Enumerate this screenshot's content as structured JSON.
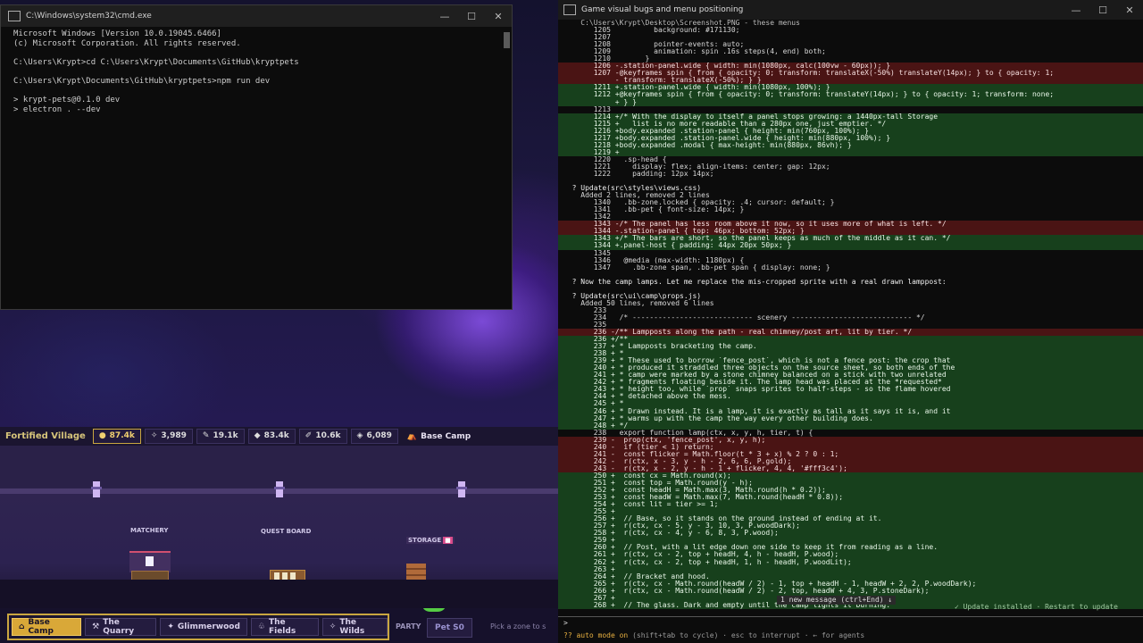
{
  "cmd": {
    "title": "C:\\Windows\\system32\\cmd.exe",
    "lines": [
      "Microsoft Windows [Version 10.0.19045.6466]",
      "(c) Microsoft Corporation. All rights reserved.",
      "",
      "C:\\Users\\Krypt>cd C:\\Users\\Krypt\\Documents\\GitHub\\kryptpets",
      "",
      "C:\\Users\\Krypt\\Documents\\GitHub\\kryptpets>npm run dev",
      "",
      "> krypt-pets@0.1.0 dev",
      "> electron . --dev"
    ]
  },
  "game": {
    "village": "Fortified Village",
    "resources": [
      {
        "icon": "coin-icon",
        "glyph": "●",
        "value": "87.4k"
      },
      {
        "icon": "crystal-icon",
        "glyph": "✧",
        "value": "3,989"
      },
      {
        "icon": "wood-icon",
        "glyph": "✎",
        "value": "19.1k"
      },
      {
        "icon": "stone-icon",
        "glyph": "◆",
        "value": "83.4k"
      },
      {
        "icon": "feather-icon",
        "glyph": "✐",
        "value": "10.6k"
      },
      {
        "icon": "gem-icon",
        "glyph": "◈",
        "value": "6,089"
      }
    ],
    "current_zone": "Base Camp",
    "buildings": {
      "matchery": "MATCHERY",
      "quest_board": "QUEST BOARD",
      "storage": "STORAGE"
    },
    "zones": [
      {
        "label": "Base Camp",
        "icon": "⌂",
        "active": true
      },
      {
        "label": "The Quarry",
        "icon": "⚒",
        "active": false
      },
      {
        "label": "Glimmerwood",
        "icon": "✦",
        "active": false
      },
      {
        "label": "The Fields",
        "icon": "♧",
        "active": false
      },
      {
        "label": "The Wilds",
        "icon": "✧",
        "active": false
      }
    ],
    "party_label": "PARTY",
    "pet_slot": "Pet S0",
    "pick_hint": "Pick a zone to s"
  },
  "terminal": {
    "title": "Game visual bugs and menu positioning",
    "lines": [
      {
        "t": "dim",
        "s": "    C:\\Users\\Krypt\\Desktop\\Screenshot.PNG - these menus"
      },
      {
        "t": "",
        "s": "       1205          background: #171130;"
      },
      {
        "t": "",
        "s": "       1207      "
      },
      {
        "t": "",
        "s": "       1208          pointer-events: auto;"
      },
      {
        "t": "",
        "s": "       1209          animation: spin .16s steps(4, end) both;"
      },
      {
        "t": "",
        "s": "       1210        }"
      },
      {
        "t": "del",
        "s": "       1206 -.station-panel.wide { width: min(1080px, calc(100vw - 60px)); }"
      },
      {
        "t": "del",
        "s": "       1207 -@keyframes spin { from { opacity: 0; transform: translateX(-50%) translateY(14px); } to { opacity: 1;"
      },
      {
        "t": "del",
        "s": "            - transform: translateX(-50%); } }"
      },
      {
        "t": "add",
        "s": "       1211 +.station-panel.wide { width: min(1080px, 100%); }"
      },
      {
        "t": "add",
        "s": "       1212 +@keyframes spin { from { opacity: 0; transform: translateY(14px); } to { opacity: 1; transform: none;"
      },
      {
        "t": "add",
        "s": "            + } }"
      },
      {
        "t": "",
        "s": "       1213"
      },
      {
        "t": "add",
        "s": "       1214 +/* With the display to itself a panel stops growing: a 1440px-tall Storage"
      },
      {
        "t": "add",
        "s": "       1215 +   list is no more readable than a 280px one, just emptier. */"
      },
      {
        "t": "add",
        "s": "       1216 +body.expanded .station-panel { height: min(760px, 100%); }"
      },
      {
        "t": "add",
        "s": "       1217 +body.expanded .station-panel.wide { height: min(880px, 100%); }"
      },
      {
        "t": "add",
        "s": "       1218 +body.expanded .modal { max-height: min(880px, 86vh); }"
      },
      {
        "t": "add",
        "s": "       1219 +"
      },
      {
        "t": "",
        "s": "       1220   .sp-head {"
      },
      {
        "t": "",
        "s": "       1221     display: flex; align-items: center; gap: 12px;"
      },
      {
        "t": "",
        "s": "       1222     padding: 12px 14px;"
      },
      {
        "t": "",
        "s": ""
      },
      {
        "t": "hdr",
        "s": "  ? Update(src\\styles\\views.css)"
      },
      {
        "t": "",
        "s": "    Added 2 lines, removed 2 lines"
      },
      {
        "t": "",
        "s": "       1340   .bb-zone.locked { opacity: .4; cursor: default; }"
      },
      {
        "t": "",
        "s": "       1341   .bb-pet { font-size: 14px; }"
      },
      {
        "t": "",
        "s": "       1342"
      },
      {
        "t": "del",
        "s": "       1343 -/* The panel has less room above it now, so it uses more of what is left. */"
      },
      {
        "t": "del",
        "s": "       1344 -.station-panel { top: 46px; bottom: 52px; }"
      },
      {
        "t": "add",
        "s": "       1343 +/* The bars are short, so the panel keeps as much of the middle as it can. */"
      },
      {
        "t": "add",
        "s": "       1344 +.panel-host { padding: 44px 20px 50px; }"
      },
      {
        "t": "",
        "s": "       1345"
      },
      {
        "t": "",
        "s": "       1346   @media (max-width: 1180px) {"
      },
      {
        "t": "",
        "s": "       1347     .bb-zone span, .bb-pet span { display: none; }"
      },
      {
        "t": "",
        "s": ""
      },
      {
        "t": "hdr",
        "s": "  ? Now the camp lamps. Let me replace the mis-cropped sprite with a real drawn lamppost:"
      },
      {
        "t": "",
        "s": ""
      },
      {
        "t": "hdr",
        "s": "  ? Update(src\\ui\\camp\\props.js)"
      },
      {
        "t": "",
        "s": "    Added 50 lines, removed 6 lines"
      },
      {
        "t": "",
        "s": "       233"
      },
      {
        "t": "",
        "s": "       234   /* ---------------------------- scenery ---------------------------- */"
      },
      {
        "t": "",
        "s": "       235"
      },
      {
        "t": "del",
        "s": "       236 -/** Lampposts along the path - real chimney/post art, lit by tier. */"
      },
      {
        "t": "add",
        "s": "       236 +/**"
      },
      {
        "t": "add",
        "s": "       237 + * Lampposts bracketing the camp."
      },
      {
        "t": "add",
        "s": "       238 + *"
      },
      {
        "t": "add",
        "s": "       239 + * These used to borrow `fence_post`, which is not a fence post: the crop that"
      },
      {
        "t": "add",
        "s": "       240 + * produced it straddled three objects on the source sheet, so both ends of the"
      },
      {
        "t": "add",
        "s": "       241 + * camp were marked by a stone chimney balanced on a stick with two unrelated"
      },
      {
        "t": "add",
        "s": "       242 + * fragments floating beside it. The lamp head was placed at the *requested*"
      },
      {
        "t": "add",
        "s": "       243 + * height too, while `prop` snaps sprites to half-steps - so the flame hovered"
      },
      {
        "t": "add",
        "s": "       244 + * detached above the mess."
      },
      {
        "t": "add",
        "s": "       245 + *"
      },
      {
        "t": "add",
        "s": "       246 + * Drawn instead. It is a lamp, it is exactly as tall as it says it is, and it"
      },
      {
        "t": "add",
        "s": "       247 + * warms up with the camp the way every other building does."
      },
      {
        "t": "add",
        "s": "       248 + */"
      },
      {
        "t": "",
        "s": "       238   export function lamp(ctx, x, y, h, tier, t) {"
      },
      {
        "t": "del",
        "s": "       239 -  prop(ctx, 'fence_post', x, y, h);"
      },
      {
        "t": "del",
        "s": "       240 -  if (tier < 1) return;"
      },
      {
        "t": "del",
        "s": "       241 -  const flicker = Math.floor(t * 3 + x) % 2 ? 0 : 1;"
      },
      {
        "t": "del",
        "s": "       242 -  r(ctx, x - 3, y - h - 2, 6, 6, P.gold);"
      },
      {
        "t": "del",
        "s": "       243 -  r(ctx, x - 2, y - h - 1 + flicker, 4, 4, '#fff3c4');"
      },
      {
        "t": "add",
        "s": "       250 +  const cx = Math.round(x);"
      },
      {
        "t": "add",
        "s": "       251 +  const top = Math.round(y - h);"
      },
      {
        "t": "add",
        "s": "       252 +  const headH = Math.max(3, Math.round(h * 0.2));"
      },
      {
        "t": "add",
        "s": "       253 +  const headW = Math.max(7, Math.round(headH * 0.8));"
      },
      {
        "t": "add",
        "s": "       254 +  const lit = tier >= 1;"
      },
      {
        "t": "add",
        "s": "       255 +"
      },
      {
        "t": "add",
        "s": "       256 +  // Base, so it stands on the ground instead of ending at it."
      },
      {
        "t": "add",
        "s": "       257 +  r(ctx, cx - 5, y - 3, 10, 3, P.woodDark);"
      },
      {
        "t": "add",
        "s": "       258 +  r(ctx, cx - 4, y - 6, 8, 3, P.wood);"
      },
      {
        "t": "add",
        "s": "       259 +"
      },
      {
        "t": "add",
        "s": "       260 +  // Post, with a lit edge down one side to keep it from reading as a line."
      },
      {
        "t": "add",
        "s": "       261 +  r(ctx, cx - 2, top + headH, 4, h - headH, P.wood);"
      },
      {
        "t": "add",
        "s": "       262 +  r(ctx, cx - 2, top + headH, 1, h - headH, P.woodLit);"
      },
      {
        "t": "add",
        "s": "       263 +"
      },
      {
        "t": "add",
        "s": "       264 +  // Bracket and hood."
      },
      {
        "t": "add",
        "s": "       265 +  r(ctx, cx - Math.round(headW / 2) - 1, top + headH - 1, headW + 2, 2, P.woodDark);"
      },
      {
        "t": "add",
        "s": "       266 +  r(ctx, cx - Math.round(headW / 2) - 2, top, headW + 4, 3, P.stoneDark);"
      },
      {
        "t": "add",
        "s": "       267 +"
      },
      {
        "t": "add",
        "s": "       268 +  // The glass. Dark and empty until the camp lights it burning."
      }
    ],
    "prompt": "> ",
    "new_message": "1 new message (ctrl+End) ↓",
    "update_note": "✓ Update installed · Restart to update",
    "mode": "?? auto mode on",
    "mode_hint": " (shift+tab to cycle) · esc to interrupt · ← for agents"
  }
}
